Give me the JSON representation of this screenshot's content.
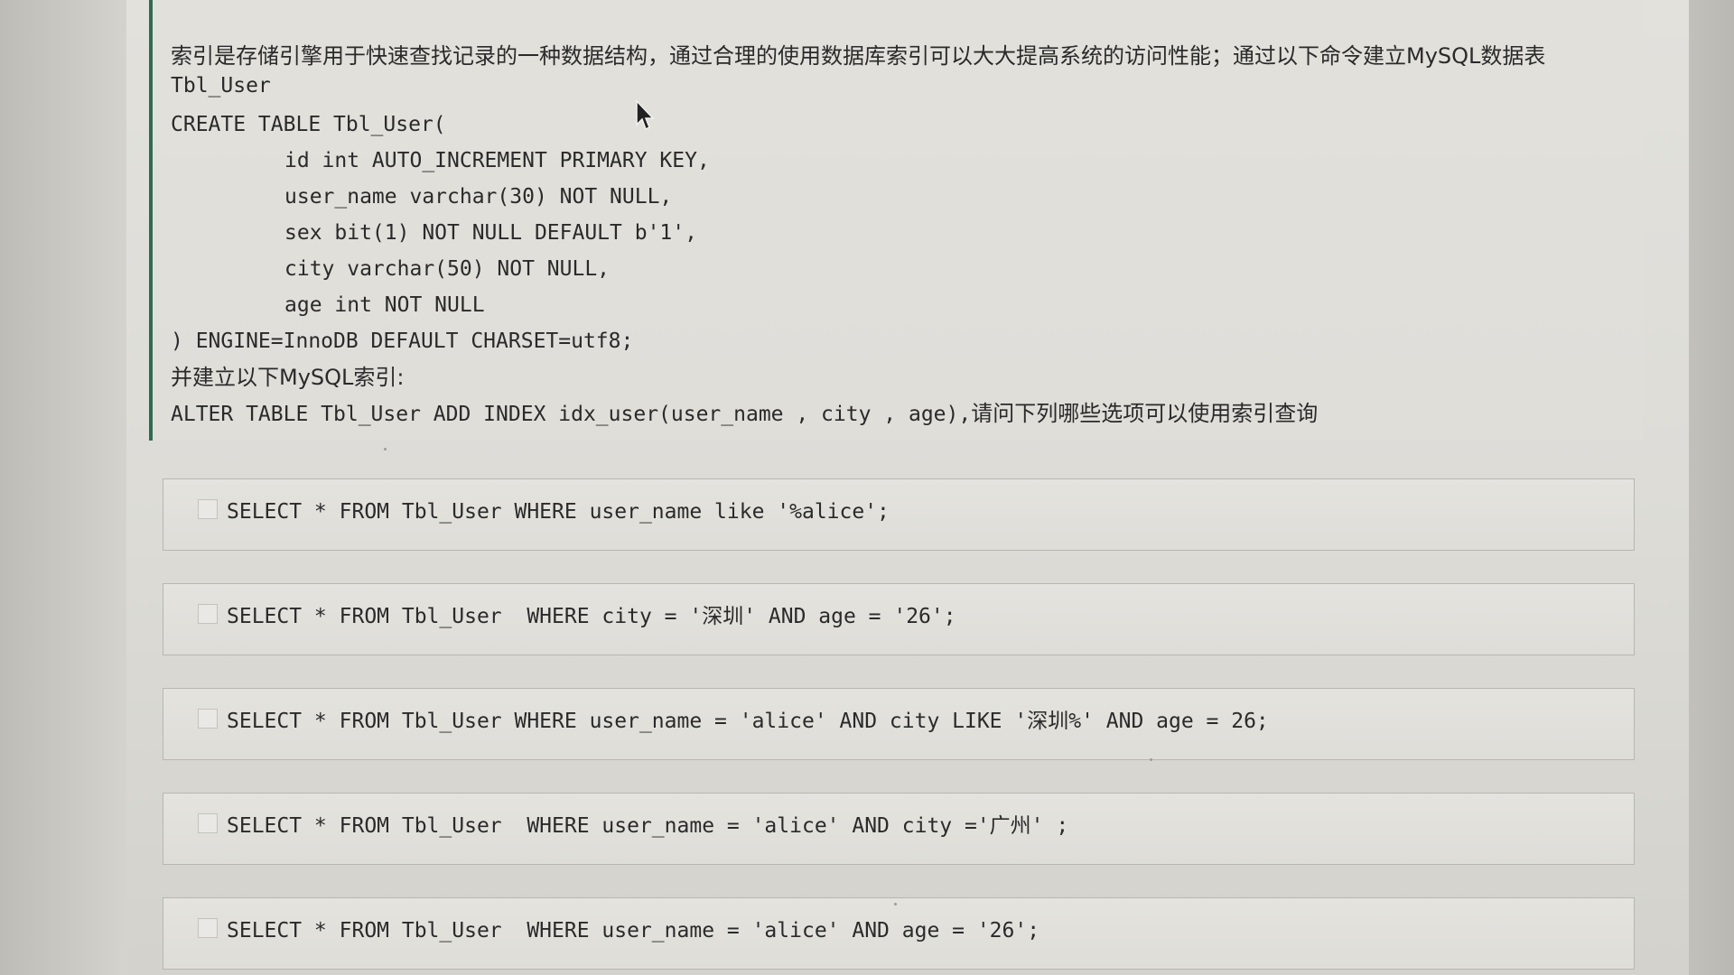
{
  "question": {
    "intro": "索引是存储引擎用于快速查找记录的一种数据结构，通过合理的使用数据库索引可以大大提高系统的访问性能；通过以下命令建立MySQL数据表",
    "table_name": "Tbl_User",
    "create_lines": [
      "CREATE TABLE Tbl_User(",
      "id int AUTO_INCREMENT PRIMARY KEY,",
      "user_name varchar(30) NOT NULL,",
      "sex bit(1) NOT NULL DEFAULT b'1',",
      "city varchar(50) NOT NULL,",
      "age int NOT NULL",
      ") ENGINE=InnoDB DEFAULT CHARSET=utf8;"
    ],
    "index_intro": "并建立以下MySQL索引:",
    "alter_statement": "ALTER TABLE Tbl_User ADD INDEX idx_user(user_name , city , age),",
    "question_tail": "请问下列哪些选项可以使用索引查询"
  },
  "options": [
    {
      "label": "SELECT * FROM Tbl_User WHERE user_name like '%alice';",
      "checked": false
    },
    {
      "label": "SELECT * FROM Tbl_User  WHERE city = '深圳' AND age = '26';",
      "checked": false
    },
    {
      "label": "SELECT * FROM Tbl_User WHERE user_name = 'alice' AND city LIKE '深圳%' AND age = 26;",
      "checked": false
    },
    {
      "label": "SELECT * FROM Tbl_User  WHERE user_name = 'alice' AND city ='广州' ;",
      "checked": false
    },
    {
      "label": "SELECT * FROM Tbl_User  WHERE user_name = 'alice' AND age = '26';",
      "checked": false
    }
  ],
  "icons": {
    "cursor": "mouse-pointer-icon",
    "checkbox": "checkbox-icon"
  },
  "colors": {
    "accent_border": "#2f6b4f",
    "text": "#2a2a2a",
    "background": "#dcdbd6"
  }
}
